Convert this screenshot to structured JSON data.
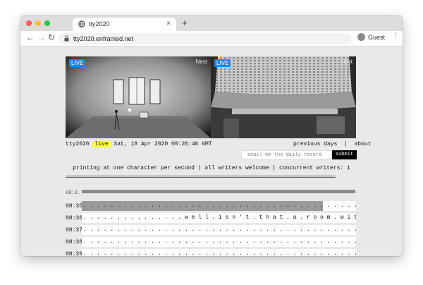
{
  "browser": {
    "tab_title": "tty2020",
    "tab_close": "×",
    "new_tab": "+",
    "url": "tty2020.enframed.net",
    "profile_label": "Guest",
    "back": "←",
    "forward": "→",
    "reload": "↻",
    "menu": "⋮"
  },
  "cameras": [
    {
      "live_label": "LIVE",
      "brand": "Nest"
    },
    {
      "live_label": "LIVE",
      "brand": "Nest"
    }
  ],
  "status": {
    "name": "tty2020",
    "live_badge": "live",
    "datetime": "Sat, 18 Apr 2020 00:26:46 GMT"
  },
  "nav": {
    "previous_days": "previous days",
    "separator": "|",
    "about": "about"
  },
  "subscribe": {
    "email_placeholder": "email me the daily record",
    "submit_label": "submit"
  },
  "info_line": "printing at one character per second | all writers welcome | concurrent writers: 1",
  "divider": "==================================================================================================",
  "header_time": "08:3.",
  "rows": [
    {
      "time": "08:35",
      "progress": 0.88,
      "text": ". . . . . . . . . . . . . . . . . . . . . . . . . . . . . . . . . . . . . . . . . . . . . . . . . . . . . . . . . . . . . . . . . . . . . . . ."
    },
    {
      "time": "08:36",
      "progress": 0,
      "text": ". . . . . . . . . . . . . . . w e l l . i s n ' t . t h a t . a . r o o m . w i t h . a . v i e w   . | . . . . . . . . . . . . . . . ."
    },
    {
      "time": "08:37",
      "progress": 0,
      "text": ". . . . . . . . . . . . . . . . . . . . . . . . . . . . . . . . . . . . . . . . . . . . . . . . . . . . . . . . . . . . . . . . . . . . . . . ."
    },
    {
      "time": "08:38",
      "progress": 0,
      "text": ". . . . . . . . . . . . . . . . . . . . . . . . . . . . . . . . . . . . . . . . . . . . . . . . . . . . . . . . . . . . . . . . . . . . . . . ."
    },
    {
      "time": "08:39",
      "progress": 0,
      "text": ". . . . . . . . . . . . . . . . . . . . . . . . . . . . . . . . . . . . . . . . . . . . . . . . . . . . . . . . . . . . . . . . . . . . . . . ."
    }
  ]
}
